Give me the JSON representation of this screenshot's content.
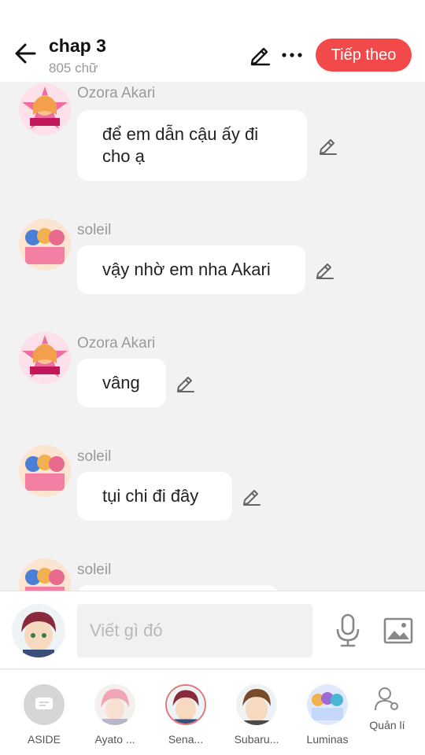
{
  "header": {
    "back_icon": "arrow-left-icon",
    "title": "chap 3",
    "subtitle": "805 chữ",
    "edit_icon": "pencil-icon",
    "more_icon": "more-dots-icon",
    "next_label": "Tiếp theo",
    "next_color": "#f24a4a"
  },
  "messages": [
    {
      "name": "Ozora Akari",
      "text": "để em dẫn cậu ấy đi cho ạ",
      "line1": "để em dẫn cậu ấy đi",
      "line2": "cho ạ"
    },
    {
      "name": "soleil",
      "text": "vậy nhờ em nha Akari"
    },
    {
      "name": "Ozora Akari",
      "text": "vâng"
    },
    {
      "name": "soleil",
      "text": "tụi chi đi đây"
    },
    {
      "name": "soleil",
      "text": ""
    }
  ],
  "composer": {
    "placeholder": "Viết gì đó",
    "mic_icon": "microphone-icon",
    "image_icon": "image-icon"
  },
  "characters": [
    {
      "label": "ASIDE"
    },
    {
      "label": "Ayato ..."
    },
    {
      "label": "Sena..."
    },
    {
      "label": "Subaru..."
    },
    {
      "label": "Luminas"
    },
    {
      "label": "Quản lí"
    }
  ]
}
